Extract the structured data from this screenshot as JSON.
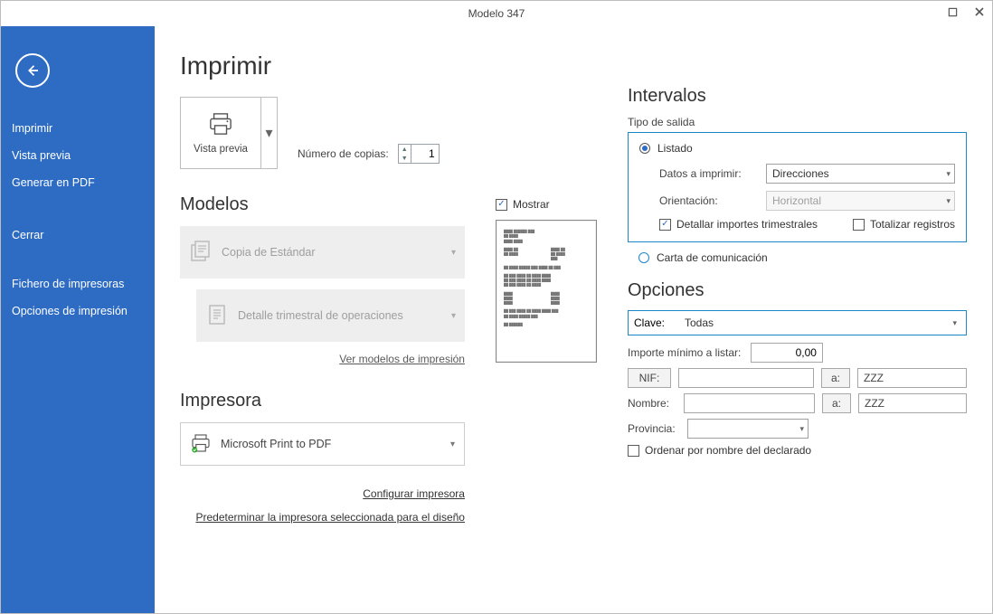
{
  "window": {
    "title": "Modelo 347"
  },
  "sidebar": {
    "items": [
      {
        "label": "Imprimir"
      },
      {
        "label": "Vista previa"
      },
      {
        "label": "Generar en PDF"
      },
      {
        "label": "Cerrar"
      },
      {
        "label": "Fichero de impresoras"
      },
      {
        "label": "Opciones de impresión"
      }
    ]
  },
  "page": {
    "title": "Imprimir"
  },
  "preview_button": {
    "label": "Vista previa"
  },
  "copies": {
    "label": "Número de copias:",
    "value": "1"
  },
  "models": {
    "heading": "Modelos",
    "items": [
      {
        "label": "Copia de Estándar"
      },
      {
        "label": "Detalle trimestral de operaciones"
      }
    ],
    "link": "Ver modelos de impresión"
  },
  "mostrar": {
    "label": "Mostrar",
    "checked": true
  },
  "printer": {
    "heading": "Impresora",
    "name": "Microsoft Print to PDF",
    "links": {
      "configure": "Configurar impresora",
      "predetermine": "Predeterminar la impresora seleccionada para el diseño"
    }
  },
  "intervals": {
    "heading": "Intervalos",
    "output_type_label": "Tipo de salida",
    "listado": "Listado",
    "datos_label": "Datos a imprimir:",
    "datos_value": "Direcciones",
    "orient_label": "Orientación:",
    "orient_value": "Horizontal",
    "detallar": {
      "label": "Detallar importes trimestrales",
      "checked": true
    },
    "totalizar": {
      "label": "Totalizar registros",
      "checked": false
    },
    "carta": "Carta de comunicación"
  },
  "options": {
    "heading": "Opciones",
    "clave_label": "Clave:",
    "clave_value": "Todas",
    "importe_label": "Importe mínimo a listar:",
    "importe_value": "0,00",
    "nif_label": "NIF:",
    "a_label": "a:",
    "nif_to": "ZZZ",
    "nombre_label": "Nombre:",
    "nombre_to": "ZZZ",
    "provincia_label": "Provincia:",
    "ordenar": {
      "label": "Ordenar por nombre del declarado",
      "checked": false
    }
  }
}
